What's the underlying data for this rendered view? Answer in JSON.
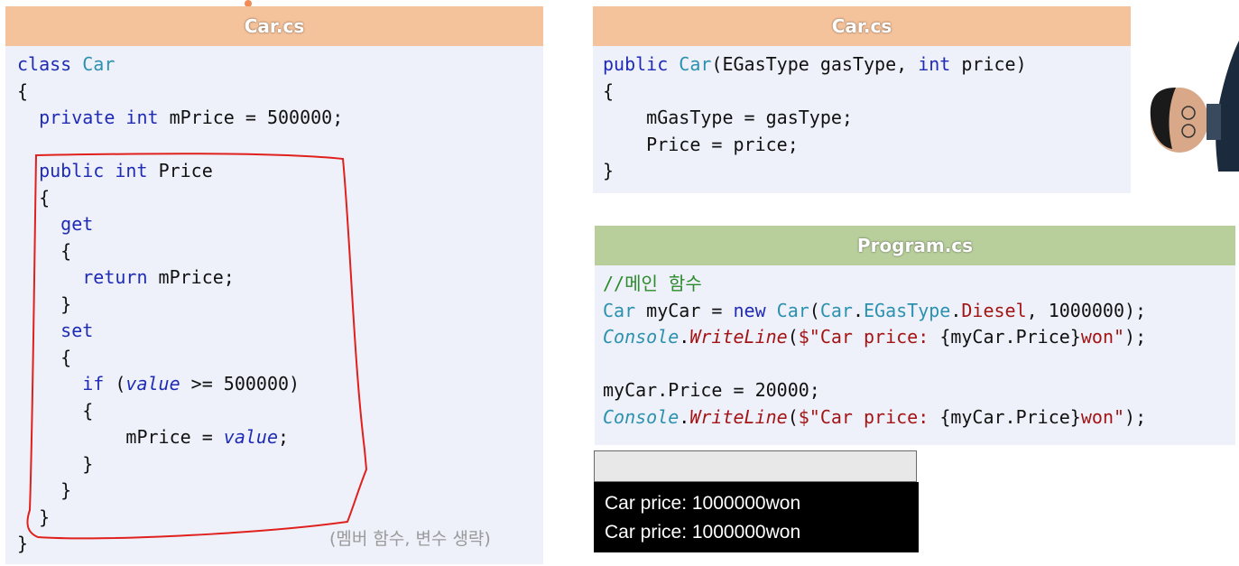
{
  "left_panel": {
    "title": "Car.cs",
    "lines": [
      [
        {
          "t": "class ",
          "c": "kw"
        },
        {
          "t": "Car",
          "c": "ty"
        }
      ],
      [
        {
          "t": "{",
          "c": ""
        }
      ],
      [
        {
          "t": "  ",
          "c": ""
        },
        {
          "t": "private ",
          "c": "kw"
        },
        {
          "t": "int ",
          "c": "kw"
        },
        {
          "t": "mPrice = 500000;",
          "c": ""
        }
      ],
      [
        {
          "t": "",
          "c": ""
        }
      ],
      [
        {
          "t": "  ",
          "c": ""
        },
        {
          "t": "public ",
          "c": "kw"
        },
        {
          "t": "int ",
          "c": "kw"
        },
        {
          "t": "Price",
          "c": ""
        }
      ],
      [
        {
          "t": "  {",
          "c": ""
        }
      ],
      [
        {
          "t": "    ",
          "c": ""
        },
        {
          "t": "get",
          "c": "kw"
        }
      ],
      [
        {
          "t": "    {",
          "c": ""
        }
      ],
      [
        {
          "t": "      ",
          "c": ""
        },
        {
          "t": "return ",
          "c": "kw"
        },
        {
          "t": "mPrice;",
          "c": ""
        }
      ],
      [
        {
          "t": "    }",
          "c": ""
        }
      ],
      [
        {
          "t": "    ",
          "c": ""
        },
        {
          "t": "set",
          "c": "kw"
        }
      ],
      [
        {
          "t": "    {",
          "c": ""
        }
      ],
      [
        {
          "t": "      ",
          "c": ""
        },
        {
          "t": "if ",
          "c": "kw"
        },
        {
          "t": "(",
          "c": ""
        },
        {
          "t": "value",
          "c": "par"
        },
        {
          "t": " >= 500000)",
          "c": ""
        }
      ],
      [
        {
          "t": "      {",
          "c": ""
        }
      ],
      [
        {
          "t": "          mPrice = ",
          "c": ""
        },
        {
          "t": "value",
          "c": "par"
        },
        {
          "t": ";",
          "c": ""
        }
      ],
      [
        {
          "t": "      }",
          "c": ""
        }
      ],
      [
        {
          "t": "    }",
          "c": ""
        }
      ],
      [
        {
          "t": "  }",
          "c": ""
        }
      ],
      [
        {
          "t": "}",
          "c": ""
        }
      ]
    ],
    "note": "(멤버 함수, 변수 생략)"
  },
  "right_top_panel": {
    "title": "Car.cs",
    "lines": [
      [
        {
          "t": "public ",
          "c": "kw"
        },
        {
          "t": "Car",
          "c": "ty"
        },
        {
          "t": "(EGasType gasType, ",
          "c": ""
        },
        {
          "t": "int ",
          "c": "kw"
        },
        {
          "t": "price)",
          "c": ""
        }
      ],
      [
        {
          "t": "{",
          "c": ""
        }
      ],
      [
        {
          "t": "    mGasType = gasType;",
          "c": ""
        }
      ],
      [
        {
          "t": "    Price = price;",
          "c": ""
        }
      ],
      [
        {
          "t": "}",
          "c": ""
        }
      ]
    ]
  },
  "program_panel": {
    "title": "Program.cs",
    "lines": [
      [
        {
          "t": "//메인 함수",
          "c": "cm"
        }
      ],
      [
        {
          "t": "Car",
          "c": "ty"
        },
        {
          "t": " myCar = ",
          "c": ""
        },
        {
          "t": "new ",
          "c": "kw"
        },
        {
          "t": "Car",
          "c": "ty"
        },
        {
          "t": "(",
          "c": ""
        },
        {
          "t": "Car",
          "c": "ty"
        },
        {
          "t": ".",
          "c": ""
        },
        {
          "t": "EGasType",
          "c": "ty"
        },
        {
          "t": ".",
          "c": ""
        },
        {
          "t": "Diesel",
          "c": "str"
        },
        {
          "t": ", 1000000);",
          "c": ""
        }
      ],
      [
        {
          "t": "Console",
          "c": "ty it"
        },
        {
          "t": ".",
          "c": ""
        },
        {
          "t": "WriteLine",
          "c": "str it"
        },
        {
          "t": "(",
          "c": ""
        },
        {
          "t": "$\"Car price: ",
          "c": "str"
        },
        {
          "t": "{myCar.Price}",
          "c": ""
        },
        {
          "t": "won\"",
          "c": "str"
        },
        {
          "t": ");",
          "c": ""
        }
      ],
      [
        {
          "t": "",
          "c": ""
        }
      ],
      [
        {
          "t": "myCar.Price = 20000;",
          "c": ""
        }
      ],
      [
        {
          "t": "Console",
          "c": "ty it"
        },
        {
          "t": ".",
          "c": ""
        },
        {
          "t": "WriteLine",
          "c": "str it"
        },
        {
          "t": "(",
          "c": ""
        },
        {
          "t": "$\"Car price: ",
          "c": "str"
        },
        {
          "t": "{myCar.Price}",
          "c": ""
        },
        {
          "t": "won\"",
          "c": "str"
        },
        {
          "t": ");",
          "c": ""
        }
      ]
    ]
  },
  "console_output": {
    "lines": [
      "Car price: 1000000won",
      "Car price: 1000000won"
    ]
  },
  "colors": {
    "keyword": "#1f2bb5",
    "type": "#2b91af",
    "string": "#a31515",
    "comment": "#2c8a2c",
    "annotation": "#e0201c"
  }
}
